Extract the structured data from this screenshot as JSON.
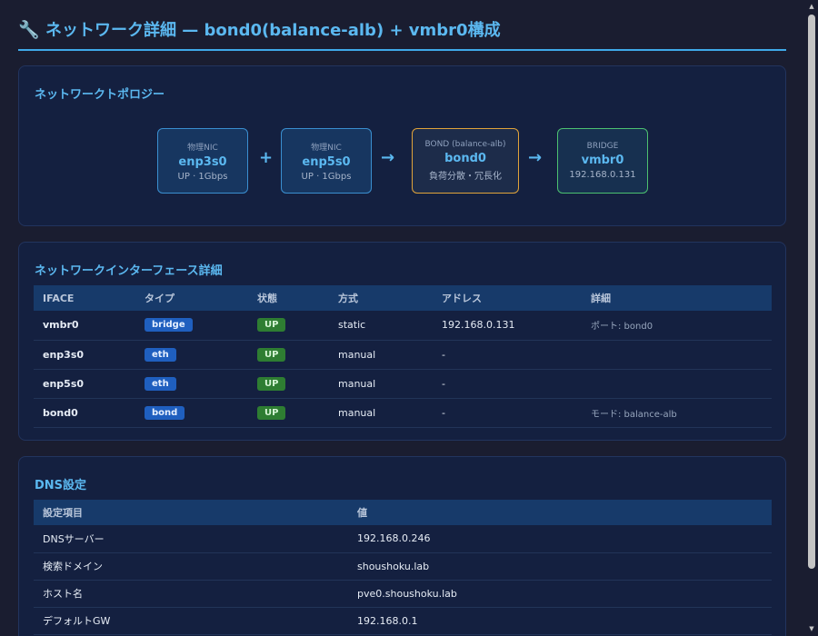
{
  "header": {
    "icon": "wrench-icon",
    "icon_glyph": "🔧",
    "title": "ネットワーク詳細 — bond0(balance-alb) + vmbr0構成"
  },
  "topology": {
    "title": "ネットワークトポロジー",
    "nodes": [
      {
        "caption": "物理NIC",
        "name": "enp3s0",
        "sub": "UP · 1Gbps"
      },
      {
        "caption": "物理NIC",
        "name": "enp5s0",
        "sub": "UP · 1Gbps"
      },
      {
        "caption": "BOND (balance-alb)",
        "name": "bond0",
        "sub": "負荷分散・冗長化"
      },
      {
        "caption": "BRIDGE",
        "name": "vmbr0",
        "sub": "192.168.0.131"
      }
    ],
    "ops": [
      "+",
      "→",
      "→"
    ]
  },
  "interfaces": {
    "title": "ネットワークインターフェース詳細",
    "columns": [
      "IFACE",
      "タイプ",
      "状態",
      "方式",
      "アドレス",
      "詳細"
    ],
    "rows": [
      {
        "iface": "vmbr0",
        "type": "bridge",
        "state": "UP",
        "method": "static",
        "address": "192.168.0.131",
        "detail": "ポート: bond0"
      },
      {
        "iface": "enp3s0",
        "type": "eth",
        "state": "UP",
        "method": "manual",
        "address": "-",
        "detail": ""
      },
      {
        "iface": "enp5s0",
        "type": "eth",
        "state": "UP",
        "method": "manual",
        "address": "-",
        "detail": ""
      },
      {
        "iface": "bond0",
        "type": "bond",
        "state": "UP",
        "method": "manual",
        "address": "-",
        "detail": "モード: balance-alb"
      }
    ]
  },
  "dns": {
    "title": "DNS設定",
    "columns": [
      "設定項目",
      "値"
    ],
    "rows": [
      {
        "key": "DNSサーバー",
        "value": "192.168.0.246"
      },
      {
        "key": "検索ドメイン",
        "value": "shoushoku.lab"
      },
      {
        "key": "ホスト名",
        "value": "pve0.shoushoku.lab"
      },
      {
        "key": "デフォルトGW",
        "value": "192.168.0.1"
      }
    ]
  },
  "colors": {
    "accent": "#5bb8f0",
    "background": "#1a1d30",
    "card": "#142040",
    "status_up": "#2e7d32",
    "bond_border": "#e0a33a",
    "bridge_border": "#4cc070"
  }
}
